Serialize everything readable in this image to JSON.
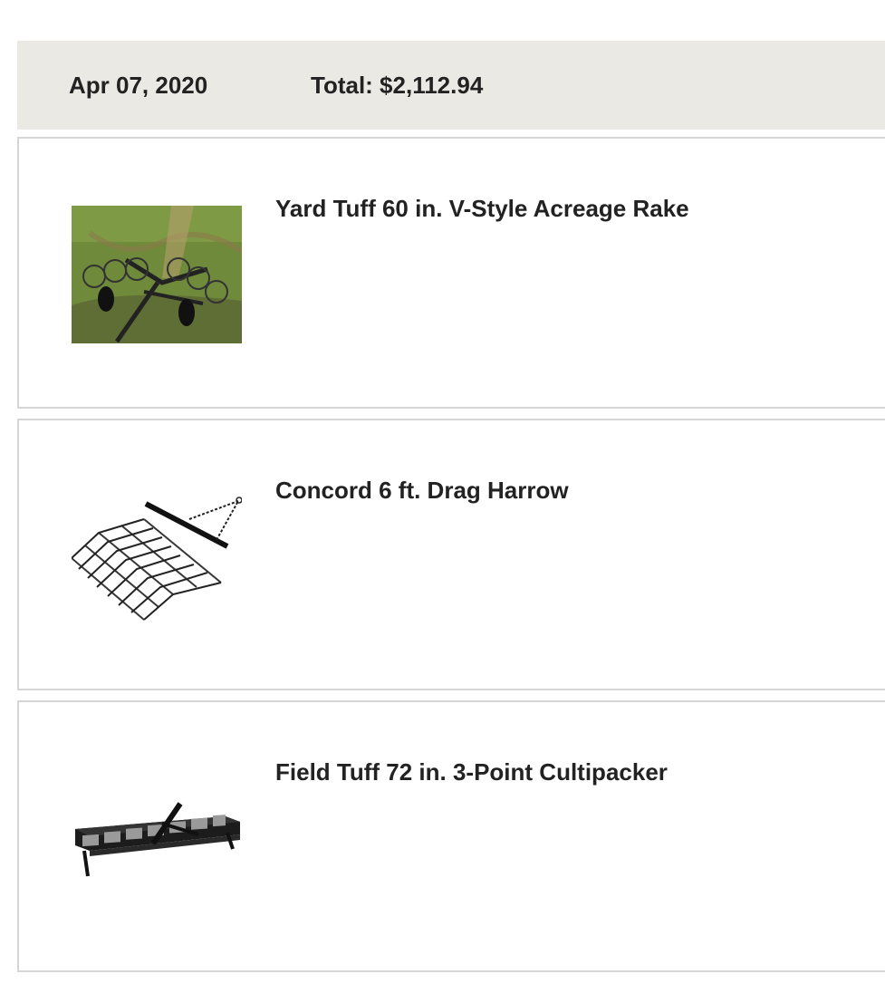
{
  "order": {
    "date": "Apr 07, 2020",
    "total": "Total: $2,112.94"
  },
  "items": [
    {
      "title": "Yard Tuff 60 in. V-Style Acreage Rake",
      "image": "acreage-rake-photo"
    },
    {
      "title": "Concord 6 ft. Drag Harrow",
      "image": "drag-harrow-photo"
    },
    {
      "title": "Field Tuff 72 in. 3-Point Cultipacker",
      "image": "cultipacker-photo"
    }
  ]
}
